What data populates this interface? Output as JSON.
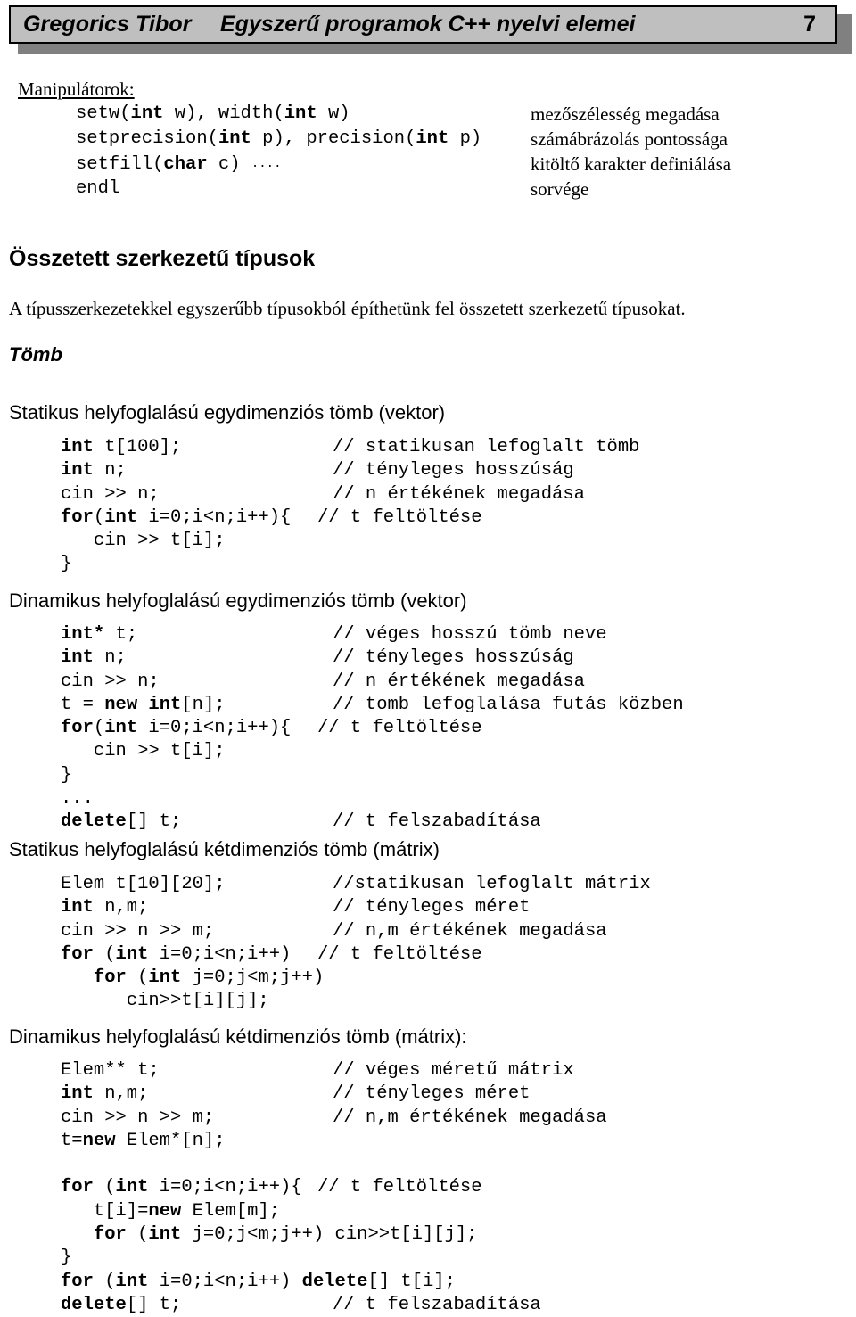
{
  "header": {
    "author": "Gregorics Tibor",
    "title": "Egyszerű programok C++ nyelvi elemei",
    "page_number": "7",
    "box_fill": "#bfbfbf",
    "shadow_color": "#808080"
  },
  "manipulators": {
    "label": "Manipulátorok:",
    "rows": [
      {
        "code_plain_1": "setw(",
        "code_bold_1": "int",
        "code_plain_2": " w), width(",
        "code_bold_2": "int",
        "code_plain_3": " w)",
        "desc": "mezőszélesség megadása"
      },
      {
        "code_plain_1": "setprecision(",
        "code_bold_1": "int",
        "code_plain_2": " p), precision(",
        "code_bold_2": "int",
        "code_plain_3": " p)",
        "desc": "számábrázolás pontossága"
      },
      {
        "code_plain_1": "setfill(",
        "code_bold_1": "char",
        "code_plain_2": " c) ",
        "code_bold_2": "",
        "code_plain_3": "....",
        "desc": "kitöltő karakter definiálása"
      },
      {
        "code_plain_1": "endl",
        "code_bold_1": "",
        "code_plain_2": "",
        "code_bold_2": "",
        "code_plain_3": "",
        "desc": "sorvége"
      }
    ]
  },
  "section": {
    "heading": "Összetett szerkezetű típusok",
    "paragraph": "A típusszerkezetekkel egyszerűbb típusokból építhetünk fel összetett szerkezetű típusokat.",
    "subheading": "Tömb"
  },
  "blocks": [
    {
      "title": "Statikus helyfoglalású egydimenziós tömb (vektor)",
      "lines": [
        {
          "code": [
            {
              "t": "int",
              "b": true
            },
            {
              "t": " t[100];",
              "b": false
            }
          ],
          "comment": "// statikusan lefoglalt tömb"
        },
        {
          "code": [
            {
              "t": "int",
              "b": true
            },
            {
              "t": " n;",
              "b": false
            }
          ],
          "comment": "// tényleges hosszúság"
        },
        {
          "code": [
            {
              "t": "cin >> n;",
              "b": false
            }
          ],
          "comment": "// n értékének megadása"
        },
        {
          "code": [
            {
              "t": "for",
              "b": true
            },
            {
              "t": "(",
              "b": false
            },
            {
              "t": "int",
              "b": true
            },
            {
              "t": " i=0;i<n;i++){",
              "b": false
            }
          ],
          "comment": "// t feltöltése",
          "comment_near": true
        },
        {
          "code": [
            {
              "t": "   cin >> t[i];",
              "b": false
            }
          ],
          "comment": ""
        },
        {
          "code": [
            {
              "t": "}",
              "b": false
            }
          ],
          "comment": ""
        }
      ]
    },
    {
      "title": "Dinamikus helyfoglalású egydimenziós tömb (vektor)",
      "lines": [
        {
          "code": [
            {
              "t": "int*",
              "b": true
            },
            {
              "t": " t;",
              "b": false
            }
          ],
          "comment": "// véges hosszú tömb neve"
        },
        {
          "code": [
            {
              "t": "int",
              "b": true
            },
            {
              "t": " n;",
              "b": false
            }
          ],
          "comment": "// tényleges hosszúság"
        },
        {
          "code": [
            {
              "t": "cin >> n;",
              "b": false
            }
          ],
          "comment": "// n értékének megadása"
        },
        {
          "code": [
            {
              "t": "t = ",
              "b": false
            },
            {
              "t": "new int",
              "b": true
            },
            {
              "t": "[n];",
              "b": false
            }
          ],
          "comment": "// tomb lefoglalása futás közben"
        },
        {
          "code": [
            {
              "t": "for",
              "b": true
            },
            {
              "t": "(",
              "b": false
            },
            {
              "t": "int",
              "b": true
            },
            {
              "t": " i=0;i<n;i++){",
              "b": false
            }
          ],
          "comment": "// t feltöltése",
          "comment_near": true
        },
        {
          "code": [
            {
              "t": "   cin >> t[i];",
              "b": false
            }
          ],
          "comment": ""
        },
        {
          "code": [
            {
              "t": "}",
              "b": false
            }
          ],
          "comment": ""
        },
        {
          "code": [
            {
              "t": "...",
              "b": false
            }
          ],
          "comment": ""
        },
        {
          "code": [
            {
              "t": "delete",
              "b": true
            },
            {
              "t": "[] t;",
              "b": false
            }
          ],
          "comment": "// t felszabadítása"
        }
      ]
    },
    {
      "title": "Statikus helyfoglalású kétdimenziós tömb (mátrix)",
      "lines": [
        {
          "code": [
            {
              "t": "Elem t[10][20];",
              "b": false
            }
          ],
          "comment": "//statikusan lefoglalt mátrix"
        },
        {
          "code": [
            {
              "t": "int",
              "b": true
            },
            {
              "t": " n,m;",
              "b": false
            }
          ],
          "comment": "// tényleges méret"
        },
        {
          "code": [
            {
              "t": "cin >> n >> m;",
              "b": false
            }
          ],
          "comment": "// n,m értékének megadása"
        },
        {
          "code": [
            {
              "t": "for",
              "b": true
            },
            {
              "t": " (",
              "b": false
            },
            {
              "t": "int",
              "b": true
            },
            {
              "t": " i=0;i<n;i++)",
              "b": false
            }
          ],
          "comment": "// t feltöltése",
          "comment_near": true
        },
        {
          "code": [
            {
              "t": "   ",
              "b": false
            },
            {
              "t": "for",
              "b": true
            },
            {
              "t": " (",
              "b": false
            },
            {
              "t": "int",
              "b": true
            },
            {
              "t": " j=0;j<m;j++)",
              "b": false
            }
          ],
          "comment": ""
        },
        {
          "code": [
            {
              "t": "      cin>>t[i][j];",
              "b": false
            }
          ],
          "comment": ""
        }
      ]
    },
    {
      "title": "Dinamikus helyfoglalású kétdimenziós tömb (mátrix):",
      "lines": [
        {
          "code": [
            {
              "t": "Elem** t;",
              "b": false
            }
          ],
          "comment": "// véges méretű mátrix"
        },
        {
          "code": [
            {
              "t": "int",
              "b": true
            },
            {
              "t": " n,m;",
              "b": false
            }
          ],
          "comment": "// tényleges méret"
        },
        {
          "code": [
            {
              "t": "cin >> n >> m;",
              "b": false
            }
          ],
          "comment": "// n,m értékének megadása"
        },
        {
          "code": [
            {
              "t": "t=",
              "b": false
            },
            {
              "t": "new",
              "b": true
            },
            {
              "t": " Elem*[n];",
              "b": false
            }
          ],
          "comment": ""
        },
        {
          "code": [
            {
              "t": "",
              "b": false
            }
          ],
          "comment": ""
        },
        {
          "code": [
            {
              "t": "for",
              "b": true
            },
            {
              "t": " (",
              "b": false
            },
            {
              "t": "int",
              "b": true
            },
            {
              "t": " i=0;i<n;i++){",
              "b": false
            }
          ],
          "comment": "// t feltöltése",
          "comment_near": true
        },
        {
          "code": [
            {
              "t": "   t[i]=",
              "b": false
            },
            {
              "t": "new",
              "b": true
            },
            {
              "t": " Elem[m];",
              "b": false
            }
          ],
          "comment": ""
        },
        {
          "code": [
            {
              "t": "   ",
              "b": false
            },
            {
              "t": "for",
              "b": true
            },
            {
              "t": " (",
              "b": false
            },
            {
              "t": "int",
              "b": true
            },
            {
              "t": " j=0;j<m;j++) cin>>t[i][j];",
              "b": false
            }
          ],
          "comment": ""
        },
        {
          "code": [
            {
              "t": "}",
              "b": false
            }
          ],
          "comment": ""
        },
        {
          "code": [
            {
              "t": "for",
              "b": true
            },
            {
              "t": " (",
              "b": false
            },
            {
              "t": "int",
              "b": true
            },
            {
              "t": " i=0;i<n;i++) ",
              "b": false
            },
            {
              "t": "delete",
              "b": true
            },
            {
              "t": "[] t[i];",
              "b": false
            }
          ],
          "comment": ""
        },
        {
          "code": [
            {
              "t": "delete",
              "b": true
            },
            {
              "t": "[] t;",
              "b": false
            }
          ],
          "comment": "// t felszabadítása"
        }
      ]
    }
  ]
}
